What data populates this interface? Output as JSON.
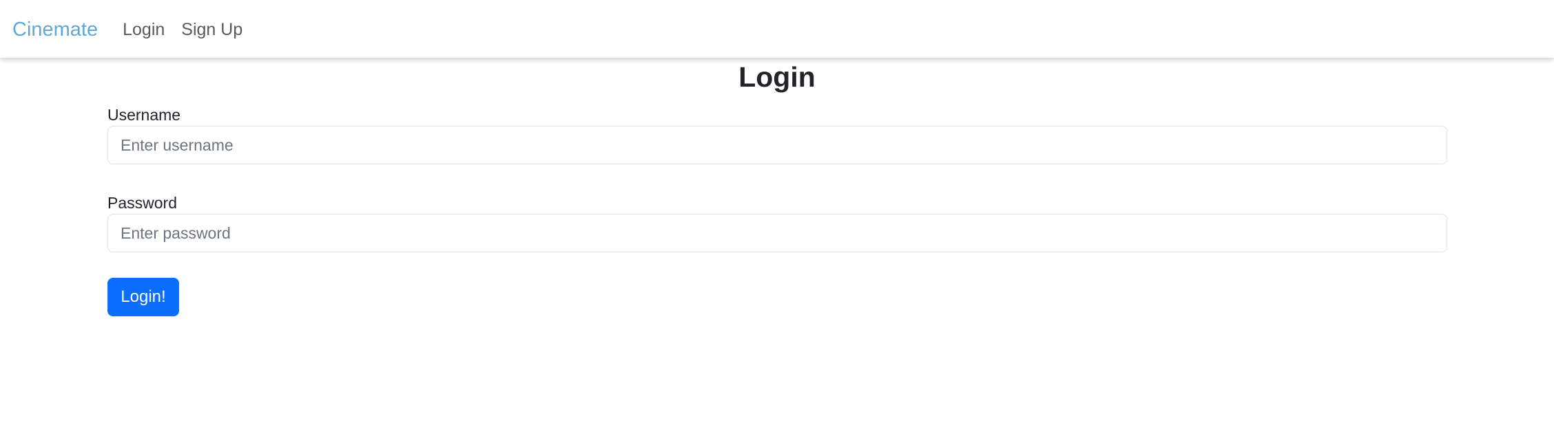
{
  "navbar": {
    "brand": "Cinemate",
    "links": [
      "Login",
      "Sign Up"
    ]
  },
  "page": {
    "title": "Login"
  },
  "form": {
    "username_label": "Username",
    "username_placeholder": "Enter username",
    "username_value": "",
    "password_label": "Password",
    "password_placeholder": "Enter password",
    "password_value": "",
    "submit_label": "Login!"
  },
  "colors": {
    "brand": "#5fa9d6",
    "primary_button": "#0d6efd",
    "nav_link": "#5a5a5a",
    "text": "#212529"
  }
}
